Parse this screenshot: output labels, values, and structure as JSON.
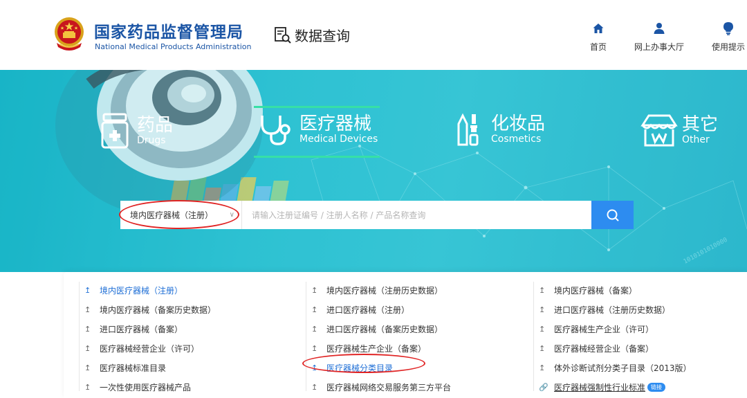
{
  "header": {
    "brand_cn": "国家药品监督管理局",
    "brand_en": "National Medical Products Administration",
    "page_title": "数据查询",
    "nav": [
      {
        "label": "首页",
        "icon": "home-icon"
      },
      {
        "label": "网上办事大厅",
        "icon": "user-icon"
      },
      {
        "label": "使用提示",
        "icon": "lightbulb-icon"
      }
    ],
    "brand_color": "#1b55a5"
  },
  "hero": {
    "categories": [
      {
        "cn": "药品",
        "en": "Drugs",
        "icon": "pill-bottle-icon"
      },
      {
        "cn": "医疗器械",
        "en": "Medical Devices",
        "icon": "stethoscope-icon",
        "active": true
      },
      {
        "cn": "化妆品",
        "en": "Cosmetics",
        "icon": "cosmetics-icon"
      },
      {
        "cn": "其它",
        "en": "Other",
        "icon": "store-icon"
      }
    ],
    "active_accent": "#36e0a6"
  },
  "search": {
    "selected": "境内医疗器械（注册）",
    "placeholder": "请输入注册证编号 / 注册人名称 / 产品名称查询",
    "button_color": "#2d8cf0"
  },
  "links": {
    "col1": [
      {
        "label": "境内医疗器械（注册）",
        "active": true
      },
      {
        "label": "境内医疗器械（备案历史数据）"
      },
      {
        "label": "进口医疗器械（备案）"
      },
      {
        "label": "医疗器械经营企业（许可）"
      },
      {
        "label": "医疗器械标准目录"
      },
      {
        "label": "一次性使用医疗器械产品"
      }
    ],
    "col2": [
      {
        "label": "境内医疗器械（注册历史数据）"
      },
      {
        "label": "进口医疗器械（注册）"
      },
      {
        "label": "进口医疗器械（备案历史数据）"
      },
      {
        "label": "医疗器械生产企业（备案）"
      },
      {
        "label": "医疗器械分类目录",
        "active": true
      },
      {
        "label": "医疗器械网络交易服务第三方平台"
      }
    ],
    "col3": [
      {
        "label": "境内医疗器械（备案）"
      },
      {
        "label": "进口医疗器械（注册历史数据）"
      },
      {
        "label": "医疗器械生产企业（许可）"
      },
      {
        "label": "医疗器械经营企业（备案）"
      },
      {
        "label": "体外诊断试剂分类子目录（2013版）"
      },
      {
        "label": "医疗器械强制性行业标准",
        "badge": "链接",
        "icon": "link-icon"
      }
    ]
  },
  "annotation_color": "#e02424"
}
